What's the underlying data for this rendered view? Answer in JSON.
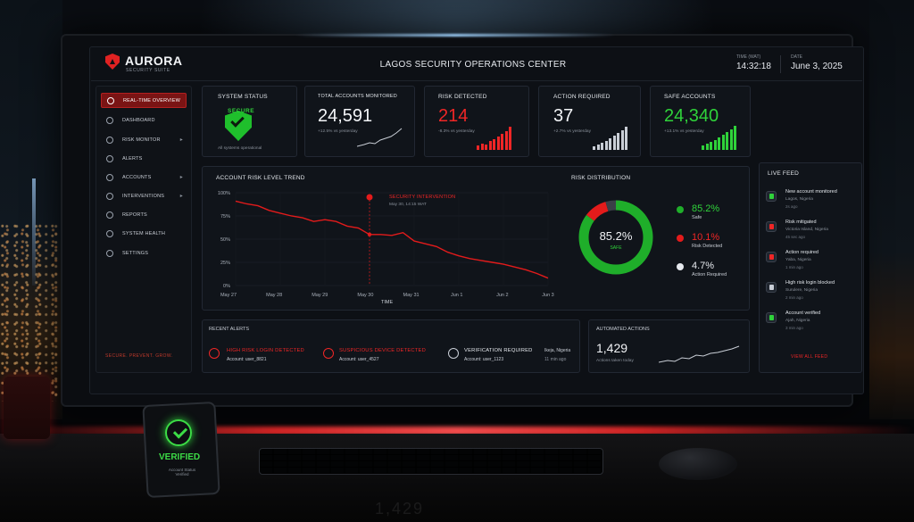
{
  "header": {
    "brand": "AURORA",
    "brand_sub": "SECURITY SUITE",
    "title": "LAGOS SECURITY OPERATIONS CENTER",
    "time_label": "TIME (WAT)",
    "time": "14:32:18",
    "date_label": "DATE",
    "date": "June 3, 2025"
  },
  "sidebar": {
    "items": [
      {
        "label": "REAL-TIME OVERVIEW",
        "icon": "target-icon",
        "active": true
      },
      {
        "label": "DASHBOARD",
        "icon": "grid-icon"
      },
      {
        "label": "RISK MONITOR",
        "icon": "shield-icon"
      },
      {
        "label": "ALERTS",
        "icon": "bell-icon"
      },
      {
        "label": "ACCOUNTS",
        "icon": "user-icon"
      },
      {
        "label": "INTERVENTIONS",
        "icon": "wrench-icon"
      },
      {
        "label": "REPORTS",
        "icon": "document-icon"
      },
      {
        "label": "SYSTEM HEALTH",
        "icon": "heart-icon"
      },
      {
        "label": "SETTINGS",
        "icon": "gear-icon"
      }
    ],
    "tagline": "SECURE. PREVENT. GROW."
  },
  "kpis": {
    "system_status": {
      "title": "SYSTEM STATUS",
      "state": "SECURE",
      "sub": "All systems operational"
    },
    "total_accounts": {
      "title": "TOTAL ACCOUNTS MONITORED",
      "value": "24,591",
      "sub": "+12.5% vs yesterday"
    },
    "risk_detected": {
      "title": "RISK DETECTED",
      "value": "214",
      "sub": "-8.3% vs yesterday"
    },
    "action_required": {
      "title": "ACTION REQUIRED",
      "value": "37",
      "sub": "+2.7% vs yesterday"
    },
    "safe_accounts": {
      "title": "SAFE ACCOUNTS",
      "value": "24,340",
      "sub": "+13.1% vs yesterday"
    }
  },
  "trend": {
    "title": "ACCOUNT RISK LEVEL TREND",
    "annotation_title": "SECURITY INTERVENTION",
    "annotation_sub": "May 30, 14:15 WAT",
    "x_axis_label": "TIME"
  },
  "chart_data": {
    "type": "line",
    "title": "ACCOUNT RISK LEVEL TREND",
    "xlabel": "TIME",
    "ylabel": "",
    "categories": [
      "May 27",
      "May 28",
      "May 29",
      "May 30",
      "May 31",
      "Jun 1",
      "Jun 2",
      "Jun 3"
    ],
    "y_ticks": [
      "100%",
      "75%",
      "50%",
      "25%",
      "0%"
    ],
    "ylim": [
      0,
      100
    ],
    "x": [
      0,
      0.25,
      0.5,
      0.75,
      1,
      1.25,
      1.5,
      1.75,
      2,
      2.25,
      2.5,
      2.75,
      3,
      3.25,
      3.5,
      3.75,
      4,
      4.25,
      4.5,
      4.75,
      5,
      5.25,
      5.5,
      5.75,
      6,
      6.25,
      6.5,
      6.75,
      7
    ],
    "series": [
      {
        "values": [
          91,
          88,
          86,
          81,
          78,
          75,
          73,
          69,
          71,
          69,
          64,
          62,
          55,
          55,
          54,
          57,
          48,
          45,
          42,
          36,
          32,
          29,
          27,
          25,
          23,
          20,
          17,
          13,
          8
        ]
      }
    ],
    "annotation_x": 3,
    "grid": true,
    "color": "#e31b1b"
  },
  "distribution": {
    "title": "RISK DISTRIBUTION",
    "center_value": "85.2%",
    "center_label": "SAFE",
    "slices": [
      {
        "value": "85.2%",
        "label": "Safe",
        "pct": 85.2,
        "color": "#1fae2a"
      },
      {
        "value": "10.1%",
        "label": "Risk Detected",
        "pct": 10.1,
        "color": "#e31b1b"
      },
      {
        "value": "4.7%",
        "label": "Action Required",
        "pct": 4.7,
        "color": "#3a3f47"
      }
    ]
  },
  "recent_alerts": {
    "title": "RECENT ALERTS",
    "items": [
      {
        "title": "HIGH RISK LOGIN DETECTED",
        "sub": "Account: user_8821"
      },
      {
        "title": "SUSPICIOUS DEVICE DETECTED",
        "sub": "Account: user_4527"
      },
      {
        "title": "VERIFICATION REQUIRED",
        "sub": "Account: user_1123",
        "location": "Ikeja, Nigeria",
        "ago": "11 min ago"
      }
    ]
  },
  "automated": {
    "title": "AUTOMATED ACTIONS",
    "value": "1,429",
    "sub": "Actions taken today"
  },
  "live_feed": {
    "title": "LIVE FEED",
    "items": [
      {
        "title": "New account monitored",
        "loc": "Lagos, Nigeria",
        "ago": "2s ago",
        "kind": "g"
      },
      {
        "title": "Risk mitigated",
        "loc": "Victoria Island, Nigeria",
        "ago": "45 sec ago",
        "kind": "r"
      },
      {
        "title": "Action required",
        "loc": "Yaba, Nigeria",
        "ago": "1 min ago",
        "kind": "r"
      },
      {
        "title": "High risk login blocked",
        "loc": "Surulere, Nigeria",
        "ago": "2 min ago",
        "kind": "w"
      },
      {
        "title": "Account verified",
        "loc": "Ajah, Nigeria",
        "ago": "3 min ago",
        "kind": "g"
      }
    ],
    "view_all": "VIEW ALL FEED"
  },
  "phone": {
    "status": "VERIFIED",
    "sub": "Account Status Verified"
  },
  "desk_reflection": "1,429"
}
